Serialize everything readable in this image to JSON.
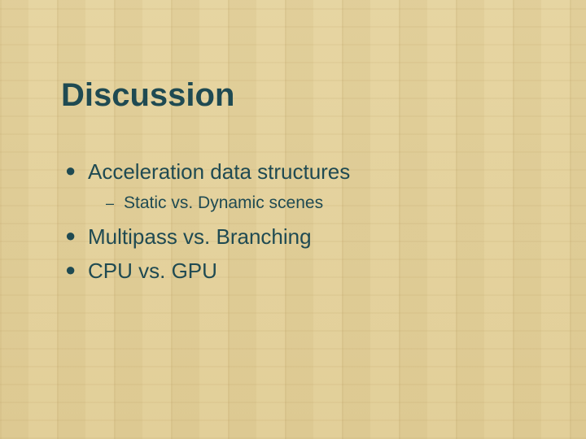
{
  "slide": {
    "title": "Discussion",
    "bullets": [
      {
        "text": "Acceleration data structures",
        "sub": [
          {
            "text": "Static vs. Dynamic scenes"
          }
        ]
      },
      {
        "text": "Multipass vs. Branching"
      },
      {
        "text": "CPU vs. GPU"
      }
    ],
    "bullet_glyph": "●",
    "dash_glyph": "–"
  }
}
